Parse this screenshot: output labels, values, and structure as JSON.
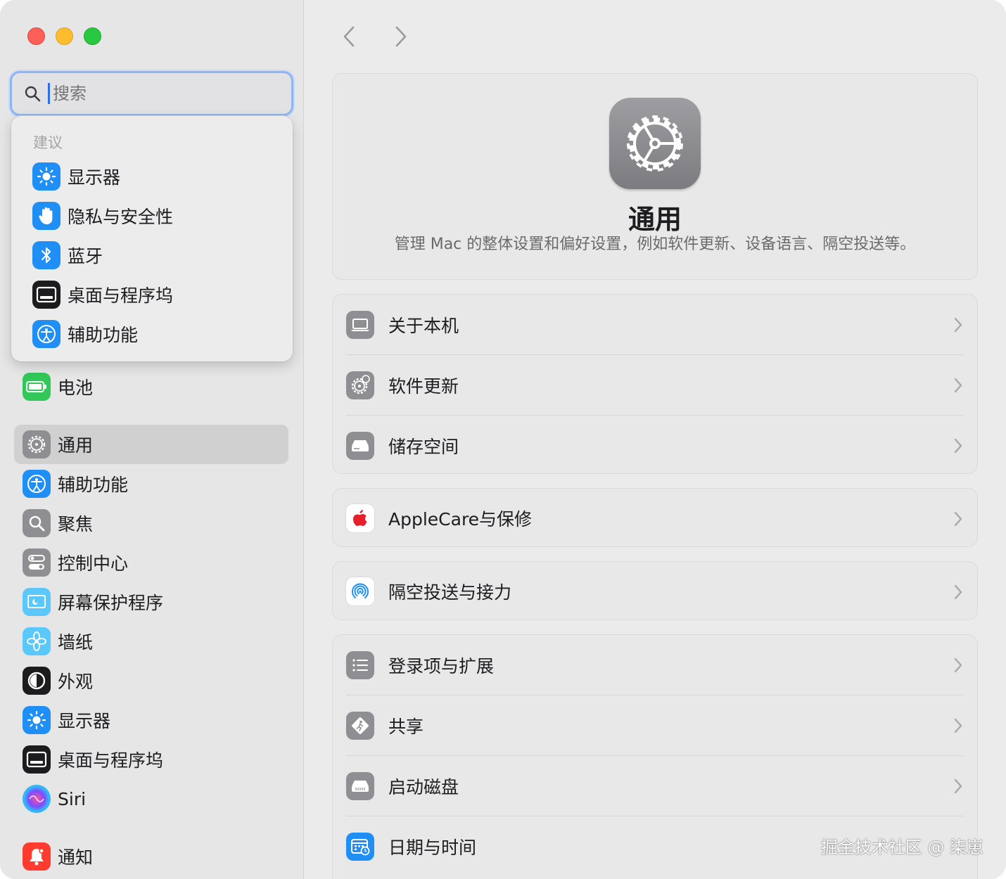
{
  "search": {
    "placeholder": "搜索"
  },
  "suggestions": {
    "heading": "建议",
    "items": [
      {
        "label": "显示器",
        "icon": "sun-icon",
        "color": "#1f8ff5"
      },
      {
        "label": "隐私与安全性",
        "icon": "hand-icon",
        "color": "#1f8ff5"
      },
      {
        "label": "蓝牙",
        "icon": "bluetooth-icon",
        "color": "#1f8ff5"
      },
      {
        "label": "桌面与程序坞",
        "icon": "dock-icon",
        "color": "#1c1c1e"
      },
      {
        "label": "辅助功能",
        "icon": "accessibility-icon",
        "color": "#1f8ff5"
      }
    ]
  },
  "sidebar": {
    "items": [
      {
        "label": "电池",
        "icon": "battery-icon",
        "color": "#32c759"
      },
      {
        "label": "通用",
        "icon": "gear-icon",
        "color": "#8e8e93",
        "selected": true
      },
      {
        "label": "辅助功能",
        "icon": "accessibility-icon",
        "color": "#1f8ff5"
      },
      {
        "label": "聚焦",
        "icon": "search-icon",
        "color": "#8e8e93"
      },
      {
        "label": "控制中心",
        "icon": "toggles-icon",
        "color": "#8e8e93"
      },
      {
        "label": "屏幕保护程序",
        "icon": "screensaver-icon",
        "color": "#5ac8fa"
      },
      {
        "label": "墙纸",
        "icon": "flower-icon",
        "color": "#5ac8fa"
      },
      {
        "label": "外观",
        "icon": "appearance-icon",
        "color": "#1c1c1e"
      },
      {
        "label": "显示器",
        "icon": "sun-icon",
        "color": "#1f8ff5"
      },
      {
        "label": "桌面与程序坞",
        "icon": "dock-icon",
        "color": "#1c1c1e"
      },
      {
        "label": "Siri",
        "icon": "siri-icon",
        "color": "#2b2b40"
      },
      {
        "label": "通知",
        "icon": "bell-icon",
        "color": "#ff3b30"
      }
    ]
  },
  "main": {
    "hero": {
      "title": "通用",
      "description": "管理 Mac 的整体设置和偏好设置，例如软件更新、设备语言、隔空投送等。"
    },
    "groups": [
      [
        {
          "label": "关于本机",
          "icon": "laptop-icon"
        },
        {
          "label": "软件更新",
          "icon": "gear-badge-icon"
        },
        {
          "label": "储存空间",
          "icon": "drive-icon"
        }
      ],
      [
        {
          "label": "AppleCare与保修",
          "icon": "apple-icon"
        }
      ],
      [
        {
          "label": "隔空投送与接力",
          "icon": "airdrop-icon"
        }
      ],
      [
        {
          "label": "登录项与扩展",
          "icon": "list-icon"
        },
        {
          "label": "共享",
          "icon": "sharing-icon"
        },
        {
          "label": "启动磁盘",
          "icon": "disk-icon"
        },
        {
          "label": "日期与时间",
          "icon": "calendar-icon"
        }
      ]
    ]
  },
  "watermark": "掘金技术社区 @ 柒崽"
}
